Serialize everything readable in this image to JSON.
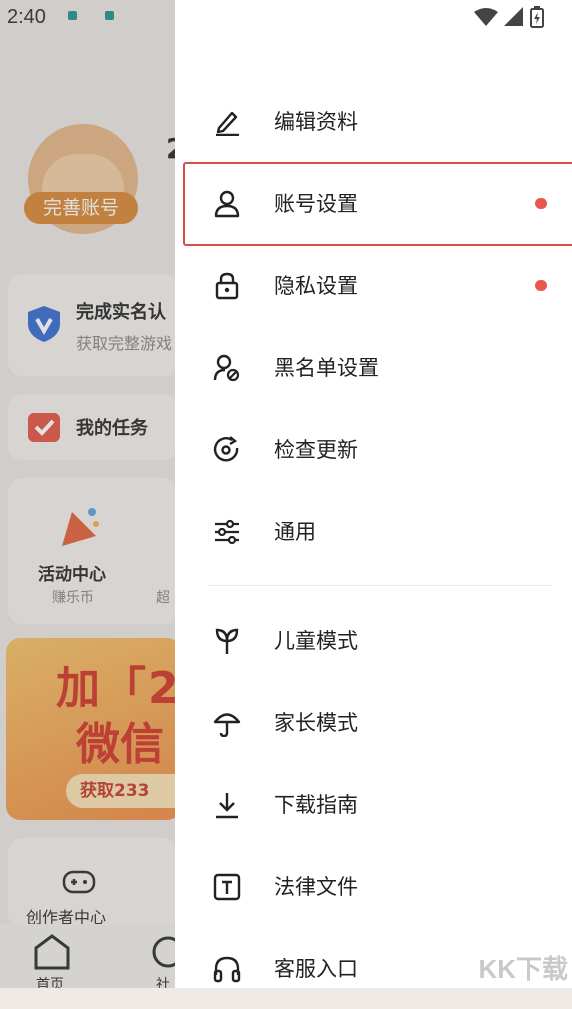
{
  "status_bar": {
    "time": "2:40",
    "icons": [
      "wifi-icon",
      "signal-icon",
      "battery-charging-icon"
    ]
  },
  "background": {
    "profile_badge": "完善账号",
    "profile_number_partial": "2",
    "realname_title": "完成实名认",
    "realname_sub": "获取完整游戏",
    "tasks_title": "我的任务",
    "activity_title": "活动中心",
    "activity_sub": "赚乐币",
    "activity_sub2": "超",
    "banner_line1": "加「2",
    "banner_line2": "微信",
    "banner_pill": "获取233",
    "creator": "创作者中心",
    "tab_home": "首页",
    "tab_community": "社"
  },
  "drawer": {
    "items": [
      {
        "label": "编辑资料",
        "icon": "edit-pencil-icon"
      },
      {
        "label": "账号设置",
        "icon": "user-icon",
        "dot": true
      },
      {
        "label": "隐私设置",
        "icon": "lock-icon",
        "dot": true
      },
      {
        "label": "黑名单设置",
        "icon": "user-block-icon"
      },
      {
        "label": "检查更新",
        "icon": "refresh-icon"
      },
      {
        "label": "通用",
        "icon": "sliders-icon"
      },
      {
        "label": "儿童模式",
        "icon": "sprout-icon"
      },
      {
        "label": "家长模式",
        "icon": "umbrella-icon"
      },
      {
        "label": "下载指南",
        "icon": "download-icon"
      },
      {
        "label": "法律文件",
        "icon": "text-document-icon"
      },
      {
        "label": "客服入口",
        "icon": "headset-icon"
      }
    ]
  },
  "watermark": "KK下载",
  "colors": {
    "accent_red": "#d94d44",
    "dot_red": "#e9584d",
    "badge_orange": "#d98a3a"
  }
}
